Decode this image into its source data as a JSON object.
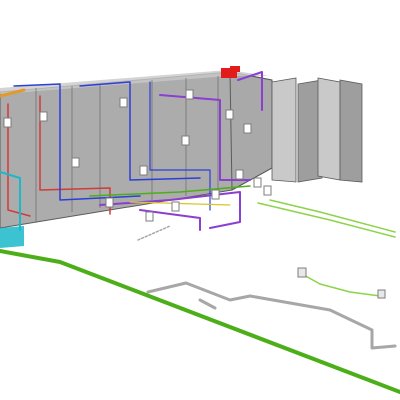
{
  "scene": {
    "kind": "3d-mep-wireframe",
    "background": "#ffffff",
    "colors": {
      "enclosure_fill": "#8c8c8c",
      "enclosure_side": "#a6a6a6",
      "enclosure_stroke": "#5a5a5a",
      "panel_fill": "#c9c9c9",
      "panel_shadow": "#9e9e9e",
      "ground_wire": "#4caf1a",
      "ground_wire_light": "#8bd44a",
      "conduit_purple": "#8a3fd1",
      "conduit_blue": "#2d3fd6",
      "conduit_red": "#d23a3a",
      "conduit_cyan": "#19b9c9",
      "conduit_orange": "#e39a2a",
      "conduit_yellow": "#d9c52a",
      "slab_outline": "#a7a7a7",
      "roof_unit": "#e21b1b",
      "junction_box": "#7d7d7d"
    },
    "icons": [
      "junction-box-icon",
      "roof-unit-icon",
      "cable-tray-icon"
    ]
  }
}
